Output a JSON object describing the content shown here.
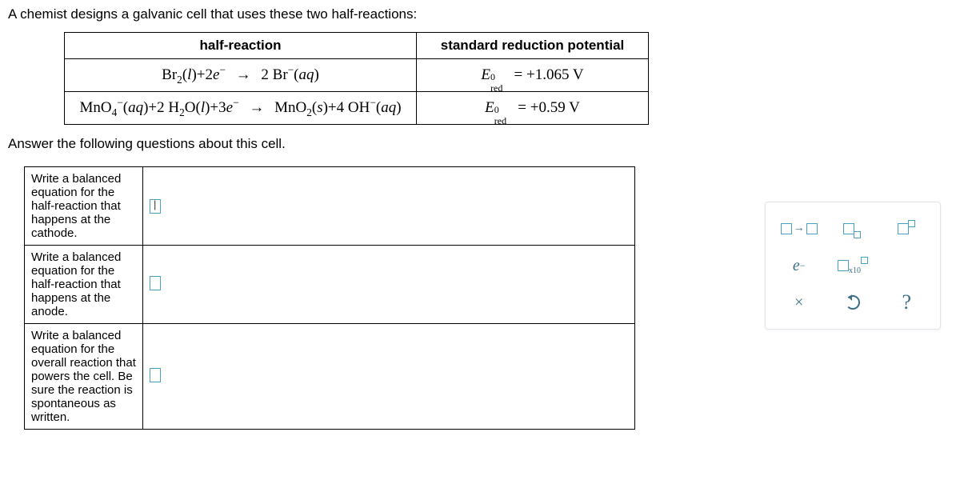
{
  "intro": "A chemist designs a galvanic cell that uses these two half-reactions:",
  "table_headers": {
    "reaction": "half-reaction",
    "potential": "standard reduction potential"
  },
  "reactions": [
    {
      "lhs_html": "Br<sub>2</sub>(<i>l</i>)+2<i>e</i><sup>−</sup>",
      "rhs_html": "2 Br<sup>−</sup>(<i>aq</i>)",
      "potential_value": "+1.065 V"
    },
    {
      "lhs_html": "MnO<sub>4</sub><sup>−</sup>(<i>aq</i>)+2 H<sub>2</sub>O(<i>l</i>)+3<i>e</i><sup>−</sup>",
      "rhs_html": "MnO<sub>2</sub>(<i>s</i>)+4 OH<sup>−</sup>(<i>aq</i>)",
      "potential_value": "+0.59 V"
    }
  ],
  "followup": "Answer the following questions about this cell.",
  "prompts": {
    "cathode": "Write a balanced equation for the half-reaction that happens at the cathode.",
    "anode": "Write a balanced equation for the half-reaction that happens at the anode.",
    "overall": "Write a balanced equation for the overall reaction that powers the cell. Be sure the reaction is spontaneous as written."
  },
  "toolbar": {
    "e_minus": "e",
    "x10": "x10",
    "help": "?",
    "close": "×"
  },
  "potential_symbol_html": "<i>E</i><span style=\"display:inline-block;position:relative;width:20px;\"><span style=\"position:absolute;top:-10px;left:0;font-size:12px;\">0</span><span style=\"position:absolute;top:4px;left:0;font-size:12px;\">red</span></span>"
}
